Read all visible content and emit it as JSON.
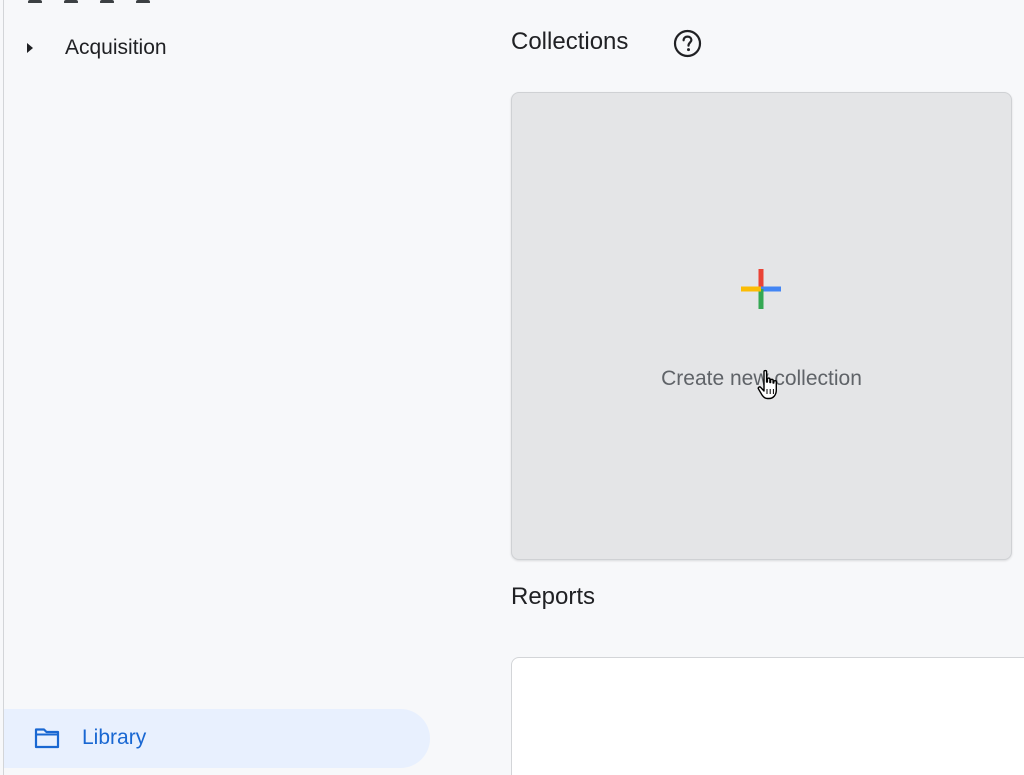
{
  "sidebar": {
    "items": [
      {
        "label": "Acquisition",
        "icon": "caret-right-icon"
      }
    ],
    "library": {
      "label": "Library",
      "icon": "folder-icon"
    }
  },
  "main": {
    "collections": {
      "title": "Collections",
      "help_icon": "help-circle-icon",
      "create_card": {
        "label": "Create new collection",
        "icon": "google-plus-icon",
        "plus_colors": [
          "#ea4335",
          "#4285f4",
          "#34a853",
          "#fbbc04"
        ]
      }
    },
    "reports": {
      "title": "Reports"
    }
  },
  "colors": {
    "accent": "#1967d2",
    "selected_bg": "#e8f0fe",
    "page_bg": "#f7f8fa",
    "card_bg": "#e4e5e7"
  }
}
